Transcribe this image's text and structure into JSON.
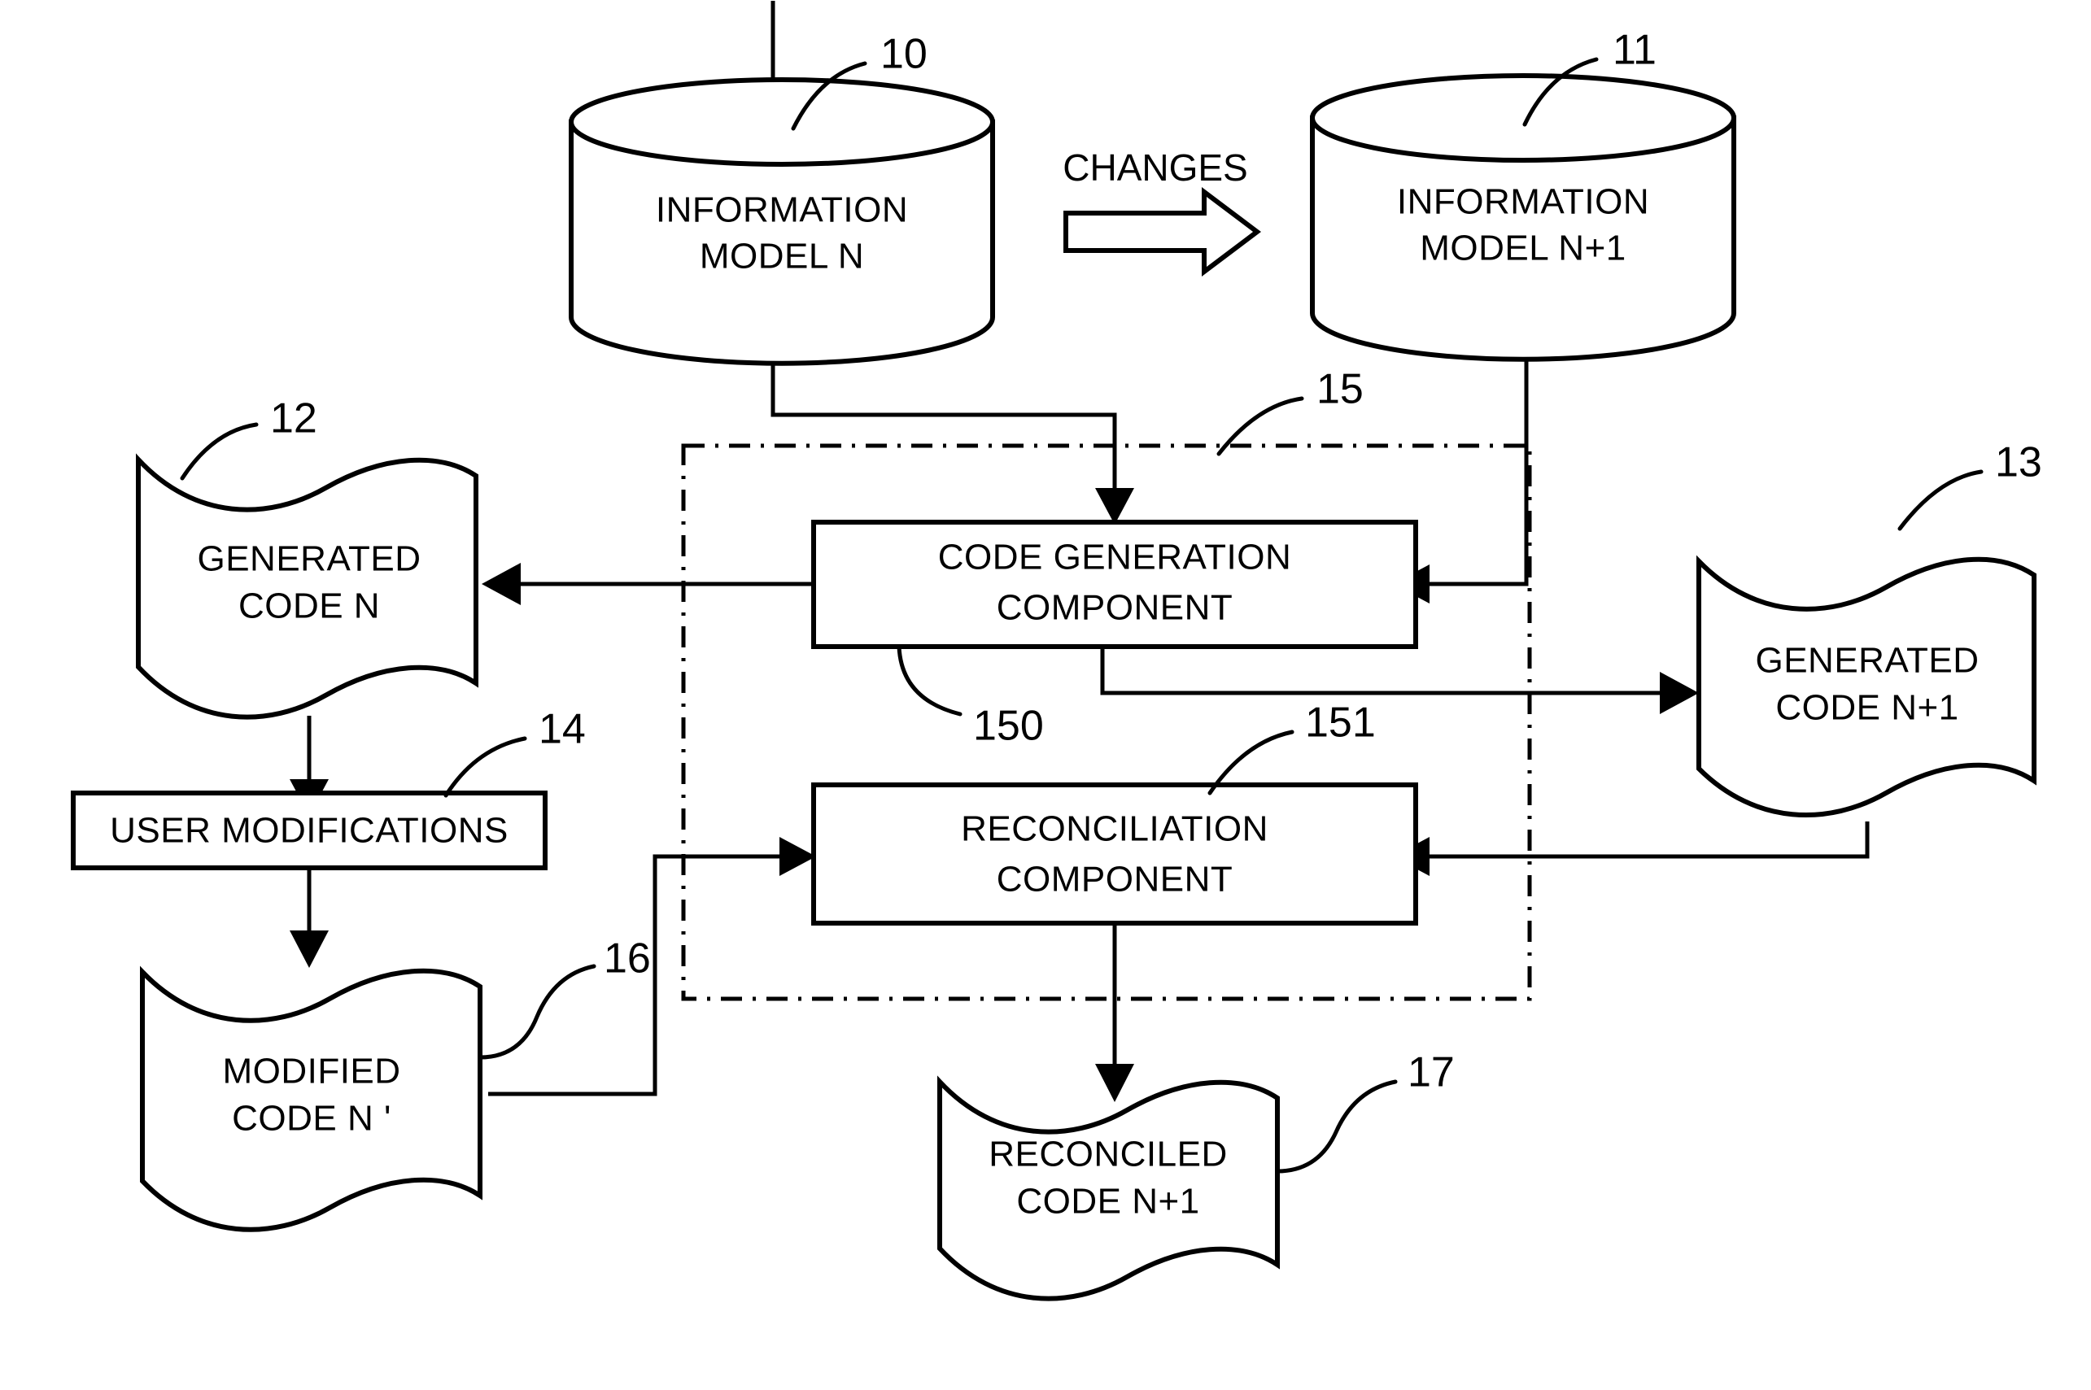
{
  "figure": {
    "title": "Code generation and reconciliation flow diagram",
    "type": "patent-flow-diagram",
    "background_color": "#ffffff",
    "line_color": "#000000"
  },
  "nodes": {
    "information_model_n": {
      "shape": "cylinder",
      "ref": "10",
      "line1": "INFORMATION",
      "line2": "MODEL N"
    },
    "information_model_n_plus_1": {
      "shape": "cylinder",
      "ref": "11",
      "line1": "INFORMATION",
      "line2": "MODEL N+1"
    },
    "generated_code_n": {
      "shape": "document",
      "ref": "12",
      "line1": "GENERATED",
      "line2": "CODE N"
    },
    "generated_code_n_plus_1": {
      "shape": "document",
      "ref": "13",
      "line1": "GENERATED",
      "line2": "CODE N+1"
    },
    "user_modifications": {
      "shape": "rectangle",
      "ref": "14",
      "line1": "USER MODIFICATIONS"
    },
    "modified_code_n_prime": {
      "shape": "document",
      "ref": "16",
      "line1": "MODIFIED",
      "line2": "CODE N '"
    },
    "code_generation_component": {
      "shape": "rectangle",
      "ref": "150",
      "line1": "CODE GENERATION",
      "line2": "COMPONENT"
    },
    "reconciliation_component": {
      "shape": "rectangle",
      "ref": "151",
      "line1": "RECONCILIATION",
      "line2": "COMPONENT"
    },
    "reconciled_code_n_plus_1": {
      "shape": "document",
      "ref": "17",
      "line1": "RECONCILED",
      "line2": "CODE N+1"
    },
    "system_boundary": {
      "shape": "dash-dot-rectangle",
      "ref": "15"
    }
  },
  "flows": {
    "changes_label": "CHANGES"
  },
  "refs": {
    "r10": "10",
    "r11": "11",
    "r12": "12",
    "r13": "13",
    "r14": "14",
    "r15": "15",
    "r16": "16",
    "r17": "17",
    "r150": "150",
    "r151": "151"
  }
}
